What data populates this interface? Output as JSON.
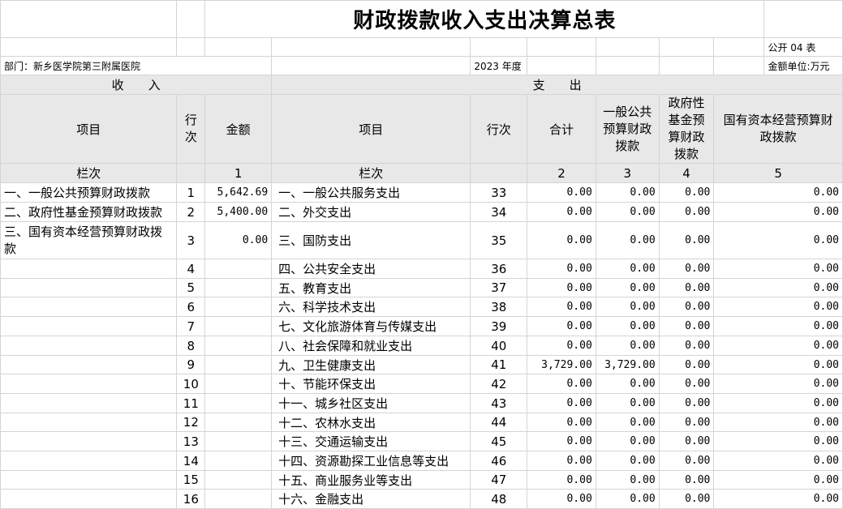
{
  "title": "财政拨款收入支出决算总表",
  "form_code": "公开 04 表",
  "department": "部门：新乡医学院第三附属医院",
  "year": "2023 年度",
  "unit": "金额单位:万元",
  "income_header": "收　　入",
  "expense_header": "支　　出",
  "columns": {
    "item": "项目",
    "row_no": "行次",
    "amount": "金额",
    "total": "合计",
    "general_budget": "一般公共预算财政拨款",
    "gov_fund": "政府性基金预算财政拨款",
    "state_capital": "国有资本经营预算财政拨款"
  },
  "column_index": {
    "label": "栏次",
    "income_amount": "1",
    "total": "2",
    "general_budget": "3",
    "gov_fund": "4",
    "state_capital": "5"
  },
  "rows": [
    {
      "in_item": "一、一般公共预算财政拨款",
      "in_no": "1",
      "in_amt": "5,642.69",
      "ex_item": "一、一般公共服务支出",
      "ex_no": "33",
      "total": "0.00",
      "gen": "0.00",
      "fund": "0.00",
      "cap": "0.00"
    },
    {
      "in_item": "二、政府性基金预算财政拨款",
      "in_no": "2",
      "in_amt": "5,400.00",
      "ex_item": "二、外交支出",
      "ex_no": "34",
      "total": "0.00",
      "gen": "0.00",
      "fund": "0.00",
      "cap": "0.00"
    },
    {
      "in_item": "三、国有资本经营预算财政拨款",
      "in_no": "3",
      "in_amt": "0.00",
      "ex_item": "三、国防支出",
      "ex_no": "35",
      "total": "0.00",
      "gen": "0.00",
      "fund": "0.00",
      "cap": "0.00"
    },
    {
      "in_item": "",
      "in_no": "4",
      "in_amt": "",
      "ex_item": "四、公共安全支出",
      "ex_no": "36",
      "total": "0.00",
      "gen": "0.00",
      "fund": "0.00",
      "cap": "0.00"
    },
    {
      "in_item": "",
      "in_no": "5",
      "in_amt": "",
      "ex_item": "五、教育支出",
      "ex_no": "37",
      "total": "0.00",
      "gen": "0.00",
      "fund": "0.00",
      "cap": "0.00"
    },
    {
      "in_item": "",
      "in_no": "6",
      "in_amt": "",
      "ex_item": "六、科学技术支出",
      "ex_no": "38",
      "total": "0.00",
      "gen": "0.00",
      "fund": "0.00",
      "cap": "0.00"
    },
    {
      "in_item": "",
      "in_no": "7",
      "in_amt": "",
      "ex_item": "七、文化旅游体育与传媒支出",
      "ex_no": "39",
      "total": "0.00",
      "gen": "0.00",
      "fund": "0.00",
      "cap": "0.00"
    },
    {
      "in_item": "",
      "in_no": "8",
      "in_amt": "",
      "ex_item": "八、社会保障和就业支出",
      "ex_no": "40",
      "total": "0.00",
      "gen": "0.00",
      "fund": "0.00",
      "cap": "0.00"
    },
    {
      "in_item": "",
      "in_no": "9",
      "in_amt": "",
      "ex_item": "九、卫生健康支出",
      "ex_no": "41",
      "total": "3,729.00",
      "gen": "3,729.00",
      "fund": "0.00",
      "cap": "0.00"
    },
    {
      "in_item": "",
      "in_no": "10",
      "in_amt": "",
      "ex_item": "十、节能环保支出",
      "ex_no": "42",
      "total": "0.00",
      "gen": "0.00",
      "fund": "0.00",
      "cap": "0.00"
    },
    {
      "in_item": "",
      "in_no": "11",
      "in_amt": "",
      "ex_item": "十一、城乡社区支出",
      "ex_no": "43",
      "total": "0.00",
      "gen": "0.00",
      "fund": "0.00",
      "cap": "0.00"
    },
    {
      "in_item": "",
      "in_no": "12",
      "in_amt": "",
      "ex_item": "十二、农林水支出",
      "ex_no": "44",
      "total": "0.00",
      "gen": "0.00",
      "fund": "0.00",
      "cap": "0.00"
    },
    {
      "in_item": "",
      "in_no": "13",
      "in_amt": "",
      "ex_item": "十三、交通运输支出",
      "ex_no": "45",
      "total": "0.00",
      "gen": "0.00",
      "fund": "0.00",
      "cap": "0.00"
    },
    {
      "in_item": "",
      "in_no": "14",
      "in_amt": "",
      "ex_item": "十四、资源勘探工业信息等支出",
      "ex_no": "46",
      "total": "0.00",
      "gen": "0.00",
      "fund": "0.00",
      "cap": "0.00"
    },
    {
      "in_item": "",
      "in_no": "15",
      "in_amt": "",
      "ex_item": "十五、商业服务业等支出",
      "ex_no": "47",
      "total": "0.00",
      "gen": "0.00",
      "fund": "0.00",
      "cap": "0.00"
    },
    {
      "in_item": "",
      "in_no": "16",
      "in_amt": "",
      "ex_item": "十六、金融支出",
      "ex_no": "48",
      "total": "0.00",
      "gen": "0.00",
      "fund": "0.00",
      "cap": "0.00"
    }
  ]
}
